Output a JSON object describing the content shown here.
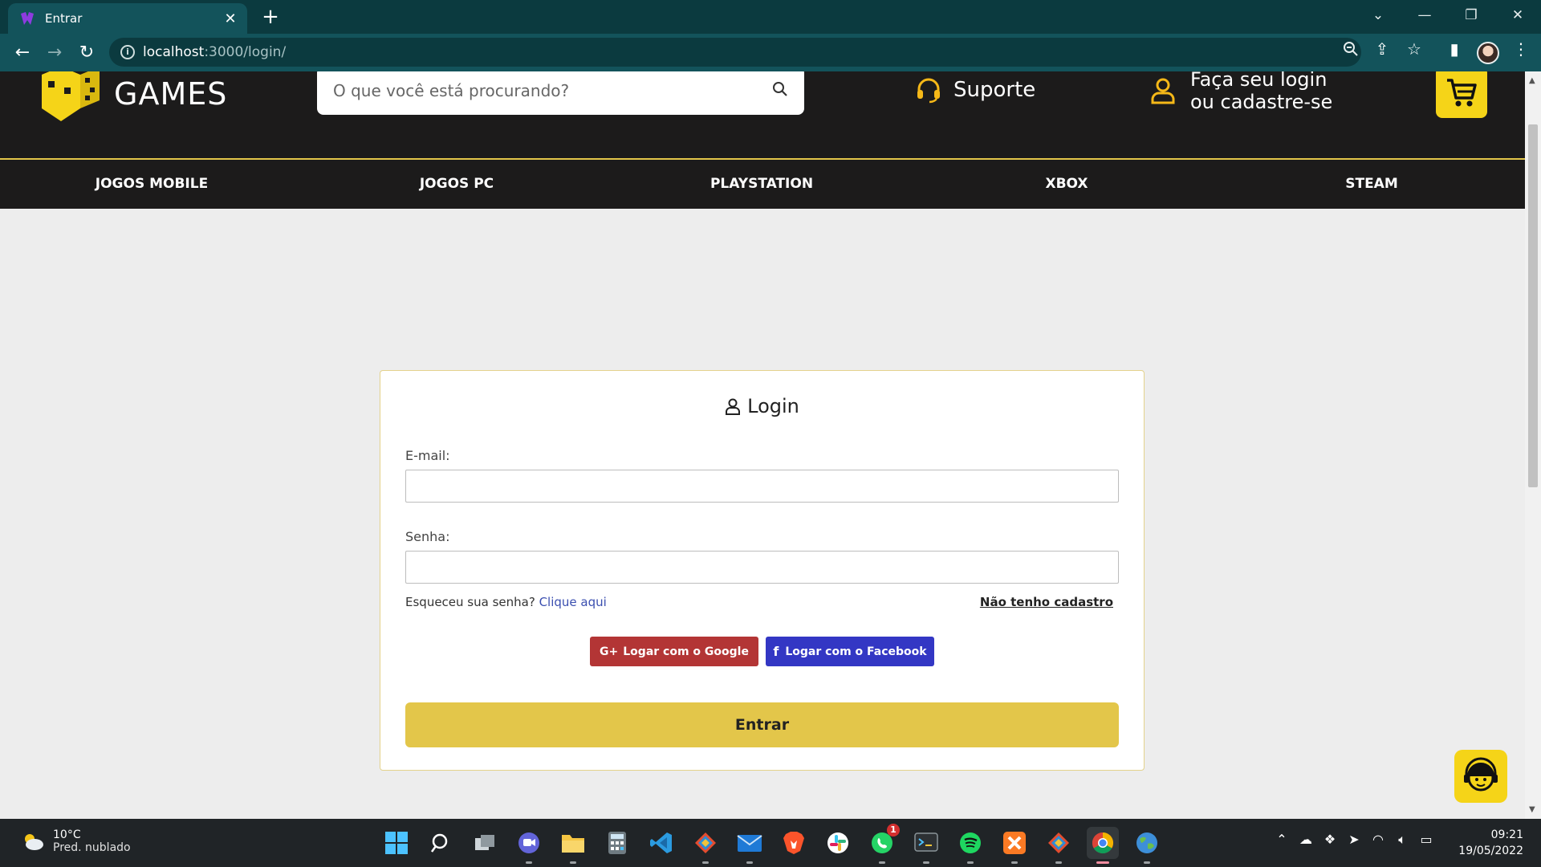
{
  "browser": {
    "tab_title": "Entrar",
    "tab_close": "✕",
    "new_tab": "+",
    "url_host": "localhost",
    "url_path": ":3000/login/",
    "window_controls": [
      "⌄",
      "—",
      "❐",
      "✕"
    ]
  },
  "header": {
    "brand": "GAMES",
    "search_placeholder": "O que você está procurando?",
    "support_label": "Suporte",
    "account_line1": "Faça seu login",
    "account_line2": "ou cadastre-se"
  },
  "nav": {
    "items": [
      "JOGOS MOBILE",
      "JOGOS PC",
      "PLAYSTATION",
      "XBOX",
      "STEAM"
    ]
  },
  "login": {
    "title": "Login",
    "email_label": "E-mail:",
    "email_value": "",
    "password_label": "Senha:",
    "password_value": "",
    "forgot_text": "Esqueceu sua senha?",
    "forgot_link": "Clique aqui",
    "no_account": "Não tenho cadastro",
    "google_button": "Logar com o Google",
    "google_prefix": "G+",
    "facebook_button": "Logar com o Facebook",
    "facebook_prefix": "f",
    "submit": "Entrar"
  },
  "taskbar": {
    "weather_temp": "10°C",
    "weather_cond": "Pred. nublado",
    "whatsapp_badge": "1",
    "time": "09:21",
    "date": "19/05/2022"
  },
  "colors": {
    "accent_yellow": "#e3c64a",
    "header_bg": "#1c1b1b",
    "google_red": "#b33535",
    "facebook_blue": "#3337c4",
    "browser_chrome": "#13535b"
  }
}
